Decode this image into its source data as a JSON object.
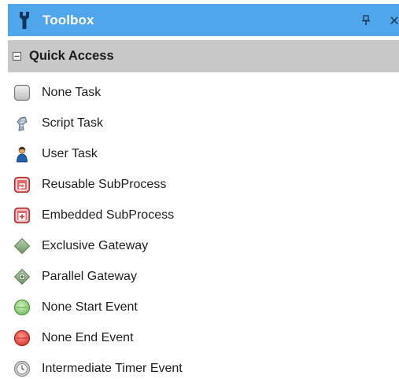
{
  "toolbox": {
    "title": "Toolbox",
    "title_icon": "toolbox-icon",
    "pin_icon": "pin-icon",
    "close_icon": "close-icon",
    "colors": {
      "title_bar": "#4fa6ea",
      "section_header": "#c8c8c8"
    }
  },
  "section": {
    "title": "Quick Access",
    "collapse_icon": "minus-box-icon",
    "items": [
      {
        "label": "None Task",
        "icon": "none-task-icon"
      },
      {
        "label": "Script Task",
        "icon": "script-task-icon"
      },
      {
        "label": "User Task",
        "icon": "user-task-icon"
      },
      {
        "label": "Reusable SubProcess",
        "icon": "reusable-subprocess-icon"
      },
      {
        "label": "Embedded SubProcess",
        "icon": "embedded-subprocess-icon"
      },
      {
        "label": "Exclusive Gateway",
        "icon": "exclusive-gateway-icon"
      },
      {
        "label": "Parallel Gateway",
        "icon": "parallel-gateway-icon"
      },
      {
        "label": "None Start Event",
        "icon": "start-event-icon"
      },
      {
        "label": "None End Event",
        "icon": "end-event-icon"
      },
      {
        "label": "Intermediate Timer Event",
        "icon": "timer-event-icon"
      }
    ]
  }
}
